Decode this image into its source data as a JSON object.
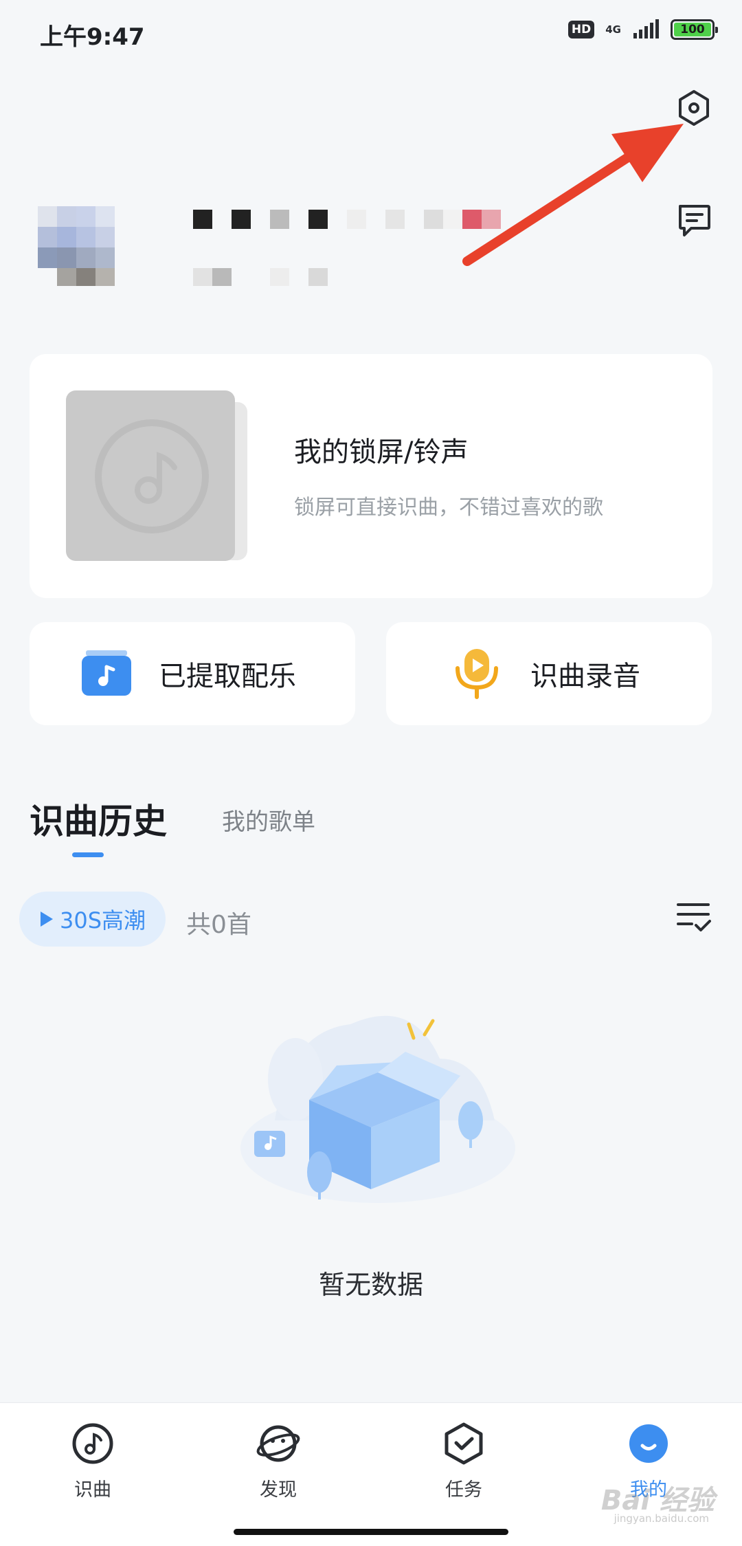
{
  "status_bar": {
    "time": "上午9:47",
    "hd": "HD",
    "network": "4G",
    "battery": "100"
  },
  "header": {
    "settings_icon": "hexagon-settings-icon",
    "message_icon": "message-icon"
  },
  "ringtone_card": {
    "title": "我的锁屏/铃声",
    "subtitle": "锁屏可直接识曲，不错过喜欢的歌"
  },
  "quick_actions": [
    {
      "label": "已提取配乐",
      "icon": "music-folder-icon"
    },
    {
      "label": "识曲录音",
      "icon": "microphone-icon"
    }
  ],
  "tabs": {
    "active": "识曲历史",
    "other": "我的歌单"
  },
  "list_controls": {
    "play_label": "30S高潮",
    "count_text": "共0首"
  },
  "empty_state": {
    "text": "暂无数据"
  },
  "bottom_nav": [
    {
      "label": "识曲",
      "icon": "music-note-icon"
    },
    {
      "label": "发现",
      "icon": "planet-icon"
    },
    {
      "label": "任务",
      "icon": "shield-check-icon"
    },
    {
      "label": "我的",
      "icon": "profile-icon"
    }
  ],
  "watermark": {
    "text": "Bai 经验",
    "sub": "jingyan.baidu.com"
  },
  "colors": {
    "accent": "#3d8ef0",
    "annotation_arrow": "#e8412b"
  }
}
